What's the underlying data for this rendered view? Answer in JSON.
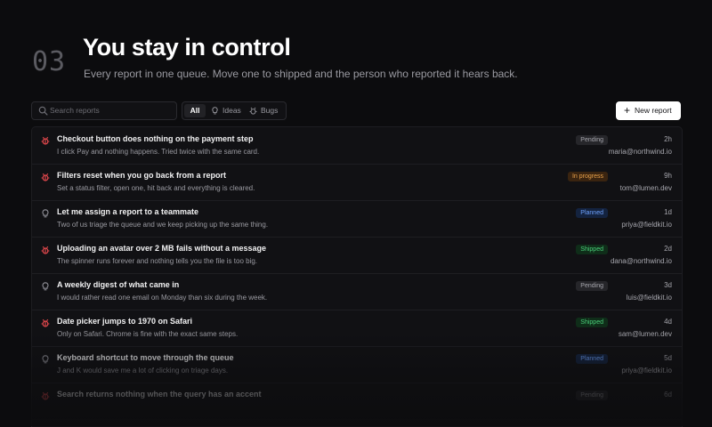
{
  "hero": {
    "number": "03",
    "title": "You stay in control",
    "subtitle": "Every report in one queue. Move one to shipped and the person who reported it hears back."
  },
  "toolbar": {
    "search_placeholder": "Search reports",
    "search_icon": "search-icon",
    "filters": [
      {
        "label": "All",
        "icon": null,
        "active": true
      },
      {
        "label": "Ideas",
        "icon": "lightbulb-icon",
        "active": false
      },
      {
        "label": "Bugs",
        "icon": "bug-icon",
        "active": false
      }
    ],
    "new_button": {
      "icon": "+",
      "label": "New report"
    }
  },
  "status_colors": {
    "Pending": "#a6a6ad",
    "In progress": "#e9a24b",
    "Planned": "#6ea2ff",
    "Shipped": "#4ad07a"
  },
  "type_colors": {
    "bug": "#e5484d",
    "idea": "#8e8e95"
  },
  "reports": [
    {
      "type": "bug",
      "title": "Checkout button does nothing on the payment step",
      "desc": "I click Pay and nothing happens. Tried twice with the same card.",
      "status": "Pending",
      "age": "2h",
      "email": "maria@northwind.io"
    },
    {
      "type": "bug",
      "title": "Filters reset when you go back from a report",
      "desc": "Set a status filter, open one, hit back and everything is cleared.",
      "status": "In progress",
      "age": "9h",
      "email": "tom@lumen.dev"
    },
    {
      "type": "idea",
      "title": "Let me assign a report to a teammate",
      "desc": "Two of us triage the queue and we keep picking up the same thing.",
      "status": "Planned",
      "age": "1d",
      "email": "priya@fieldkit.io"
    },
    {
      "type": "bug",
      "title": "Uploading an avatar over 2 MB fails without a message",
      "desc": "The spinner runs forever and nothing tells you the file is too big.",
      "status": "Shipped",
      "age": "2d",
      "email": "dana@northwind.io"
    },
    {
      "type": "idea",
      "title": "A weekly digest of what came in",
      "desc": "I would rather read one email on Monday than six during the week.",
      "status": "Pending",
      "age": "3d",
      "email": "luis@fieldkit.io"
    },
    {
      "type": "bug",
      "title": "Date picker jumps to 1970 on Safari",
      "desc": "Only on Safari. Chrome is fine with the exact same steps.",
      "status": "Shipped",
      "age": "4d",
      "email": "sam@lumen.dev"
    },
    {
      "type": "idea",
      "title": "Keyboard shortcut to move through the queue",
      "desc": "J and K would save me a lot of clicking on triage days.",
      "status": "Planned",
      "age": "5d",
      "email": "priya@fieldkit.io"
    },
    {
      "type": "bug",
      "title": "Search returns nothing when the query has an accent",
      "desc": "",
      "status": "Pending",
      "age": "6d",
      "email": ""
    }
  ]
}
